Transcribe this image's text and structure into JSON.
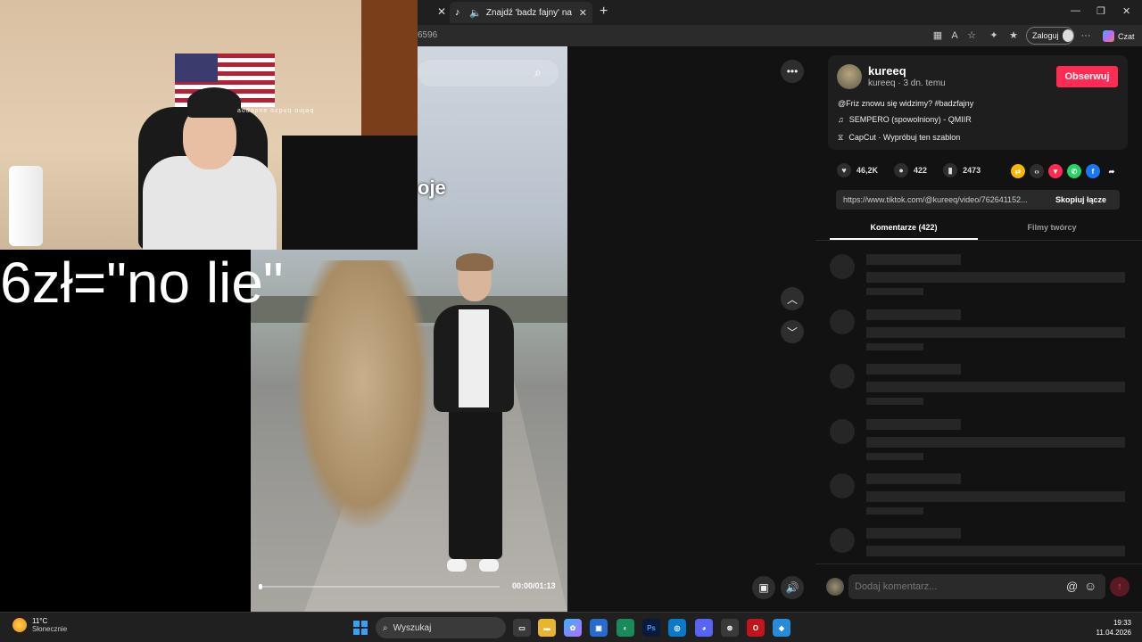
{
  "browser": {
    "active_tab_title": "Znajdź 'badz fajny' na TikTok |",
    "url_fragment": "6596",
    "login_label": "Zaloguj",
    "chat_label": "Czat"
  },
  "stream_overlay": {
    "caption": "6zł=\"no lie\"",
    "webcam_text": "aodapne ozpuq oujaq"
  },
  "video": {
    "caption_fragment": "oje",
    "time": "00:00/01:13",
    "progress": 0.0
  },
  "post": {
    "author_name": "kureeq",
    "author_meta": "kureeq · 3 dn. temu",
    "follow_label": "Obserwuj",
    "description": "@Friz znowu się widzimy? #badzfajny",
    "music": "SEMPERO (spowolniony) - QMIIR",
    "capcut": "CapCut · Wypróbuj ten szablon",
    "likes": "46,2K",
    "comments": "422",
    "saves": "2473",
    "link": "https://www.tiktok.com/@kureeq/video/762641152...",
    "copy_label": "Skopiuj łącze"
  },
  "tabs": {
    "comments": "Komentarze (422)",
    "creator_videos": "Filmy twórcy"
  },
  "comment_box": {
    "placeholder": "Dodaj komentarz...",
    "at": "@"
  },
  "taskbar": {
    "temperature": "11°C",
    "condition": "Słonecznie",
    "search_label": "Wyszukaj",
    "time": "19:33",
    "date": "11.04.2026"
  },
  "colors": {
    "follow": "#fe2c55",
    "background": "#121212"
  }
}
